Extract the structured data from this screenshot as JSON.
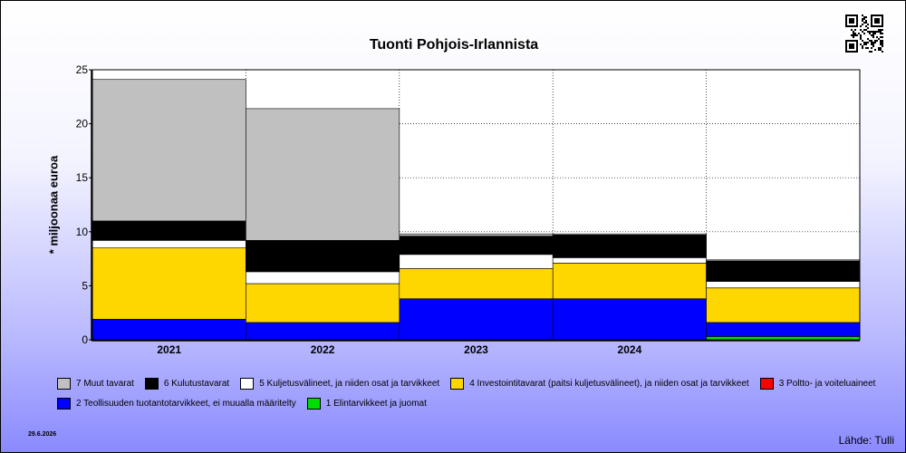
{
  "chart_data": {
    "type": "bar",
    "stacked": true,
    "title": "Tuonti Pohjois-Irlannista",
    "ylabel": "* miljoonaa euroa",
    "ylim": [
      0,
      25
    ],
    "yticks": [
      "0",
      "5",
      "10",
      "15",
      "20",
      "25"
    ],
    "categories": [
      "2021",
      "2022",
      "2023",
      "2024",
      ""
    ],
    "grid": true,
    "legend_position": "bottom",
    "series": [
      {
        "name": "1 Elintarvikkeet ja juomat",
        "color": "#00dd00",
        "values": [
          0,
          0,
          0,
          0,
          0.3
        ]
      },
      {
        "name": "2 Teollisuuden tuotantotarvikkeet, ei muualla määritelty",
        "color": "#0000ff",
        "values": [
          1.9,
          1.6,
          3.8,
          3.8,
          1.3
        ]
      },
      {
        "name": "3 Poltto- ja voiteluaineet",
        "color": "#ff0000",
        "values": [
          0,
          0,
          0,
          0,
          0
        ]
      },
      {
        "name": "4 Investointitavarat (paitsi kuljetusvälineet), ja niiden osat ja tarvikkeet",
        "color": "#ffd700",
        "values": [
          6.6,
          3.6,
          2.8,
          3.3,
          3.2
        ]
      },
      {
        "name": "5 Kuljetusvälineet, ja niiden osat ja tarvikkeet",
        "color": "#ffffff",
        "values": [
          0.7,
          1.1,
          1.3,
          0.5,
          0.6
        ]
      },
      {
        "name": "6 Kulutustavarat",
        "color": "#000000",
        "values": [
          1.8,
          2.9,
          1.7,
          2.1,
          1.9
        ]
      },
      {
        "name": "7 Muut tavarat",
        "color": "#c0c0c0",
        "values": [
          13.1,
          12.2,
          0.2,
          0.1,
          0.1
        ]
      }
    ]
  },
  "legend": {
    "row1": [
      6,
      5,
      4,
      3,
      2
    ],
    "row2": [
      1,
      0
    ]
  },
  "footer": {
    "date": "29.6.2026",
    "source": "Lähde: Tulli"
  },
  "icons": {
    "qr": "qr-code-icon"
  }
}
